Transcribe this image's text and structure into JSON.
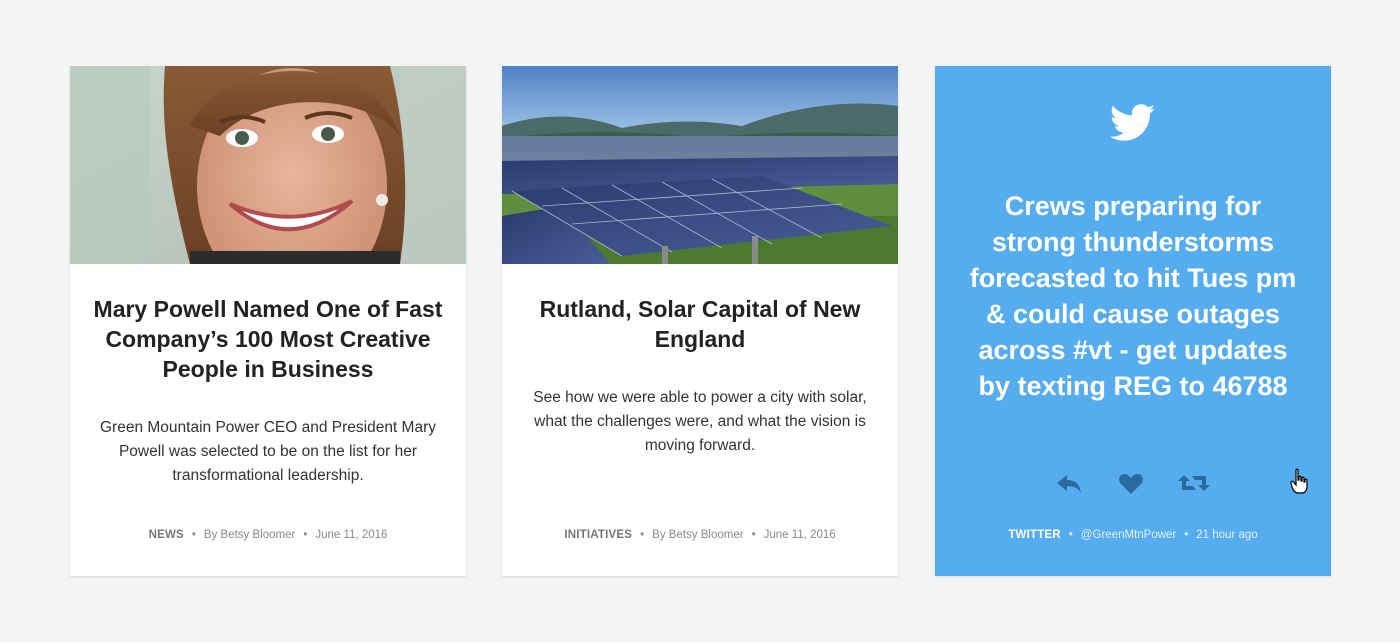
{
  "cards": [
    {
      "image": "portrait-photo",
      "title": "Mary Powell Named One of Fast Company’s 100 Most Creative People in Business",
      "excerpt": "Green Mountain Power CEO and President Mary Powell was selected to be on the list for her transformational leadership.",
      "category": "NEWS",
      "author": "By Betsy Bloomer",
      "date": "June 11, 2016"
    },
    {
      "image": "solar-panels-photo",
      "title": "Rutland, Solar Capital of New England",
      "excerpt": "See how we were able to power a city with solar, what the challenges were, and what the vision is moving forward.",
      "category": "INITIATIVES",
      "author": "By Betsy Bloomer",
      "date": "June 11, 2016"
    }
  ],
  "tweet_card": {
    "icon": "twitter-bird-icon",
    "text": "Crews preparing for strong thunderstorms forecasted to hit Tues pm & could cause outages across #vt - get updates by texting REG to 46788",
    "actions": [
      "reply-icon",
      "heart-icon",
      "retweet-icon"
    ],
    "category": "TWITTER",
    "handle": "@GreenMtnPower",
    "time": "21 hour ago",
    "bg_color": "#55acee"
  },
  "colors": {
    "page_bg": "#f4f4f4",
    "card_bg": "#ffffff",
    "title": "#222222",
    "twitter_blue": "#55acee"
  }
}
